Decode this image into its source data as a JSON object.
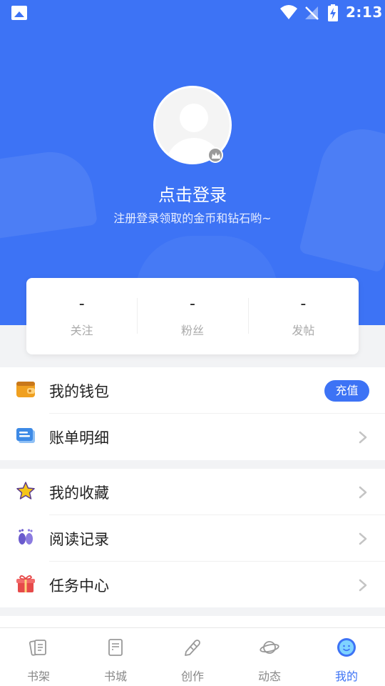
{
  "status_bar": {
    "time": "2:13"
  },
  "profile": {
    "title": "点击登录",
    "subtitle": "注册登录领取的金币和钻石哟~"
  },
  "stats": [
    {
      "value": "-",
      "label": "关注"
    },
    {
      "value": "-",
      "label": "粉丝"
    },
    {
      "value": "-",
      "label": "发帖"
    }
  ],
  "menu": {
    "wallet": {
      "label": "我的钱包",
      "recharge_label": "充值"
    },
    "bills": {
      "label": "账单明细"
    },
    "favorites": {
      "label": "我的收藏"
    },
    "history": {
      "label": "阅读记录"
    },
    "tasks": {
      "label": "任务中心"
    }
  },
  "nav": {
    "items": [
      {
        "label": "书架",
        "icon": "bookshelf-icon"
      },
      {
        "label": "书城",
        "icon": "book-icon"
      },
      {
        "label": "创作",
        "icon": "pencil-icon"
      },
      {
        "label": "动态",
        "icon": "planet-icon"
      },
      {
        "label": "我的",
        "icon": "profile-face-icon"
      }
    ],
    "active_index": 4
  },
  "colors": {
    "accent": "#3d73f5",
    "wallet": "#f0a020",
    "bill": "#3d8ae6",
    "star": "#f5c518",
    "history": "#6a5acd",
    "gift": "#e64a4a"
  }
}
